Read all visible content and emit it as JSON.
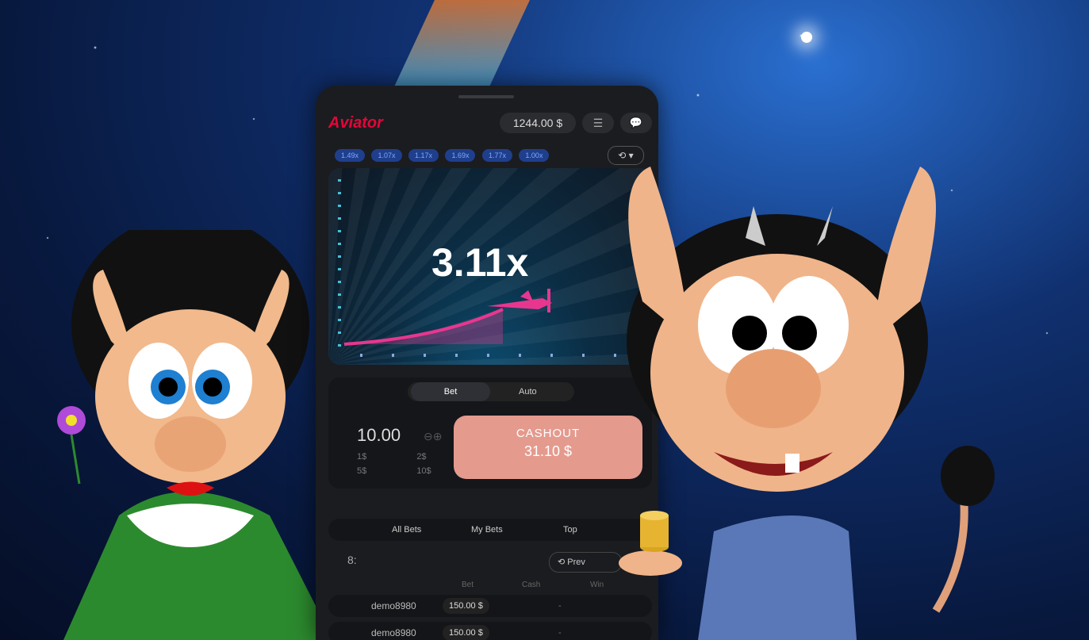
{
  "app": {
    "logo": "Aviator",
    "balance": "1244.00 $",
    "menu_icon": "menu-icon",
    "chat_icon": "chat-icon"
  },
  "history": {
    "chips": [
      "1.49x",
      "1.07x",
      "1.17x",
      "1.69x",
      "1.77x",
      "1.00x"
    ],
    "button_icon": "history-icon"
  },
  "game": {
    "multiplier": "3.11x"
  },
  "bet_panel": {
    "tabs": [
      "Bet",
      "Auto"
    ],
    "amount": "10.00",
    "quick": [
      "1$",
      "2$",
      "5$",
      "10$"
    ],
    "cashout_label": "CASHOUT",
    "cashout_amount": "31.10 $"
  },
  "bets_list": {
    "tabs": [
      "All Bets",
      "My Bets",
      "Top"
    ],
    "count_label": "8:",
    "prev_label": "Prev",
    "columns": [
      "Bet",
      "Cash",
      "Win"
    ],
    "rows": [
      {
        "user": "demo8980",
        "bet": "150.00 $",
        "status": "-"
      },
      {
        "user": "demo8980",
        "bet": "150.00 $",
        "status": "-"
      }
    ]
  },
  "colors": {
    "accent": "#e50539",
    "chip": "#1f3f8d",
    "cashout": "#e59a8e",
    "plane": "#e8368f"
  }
}
